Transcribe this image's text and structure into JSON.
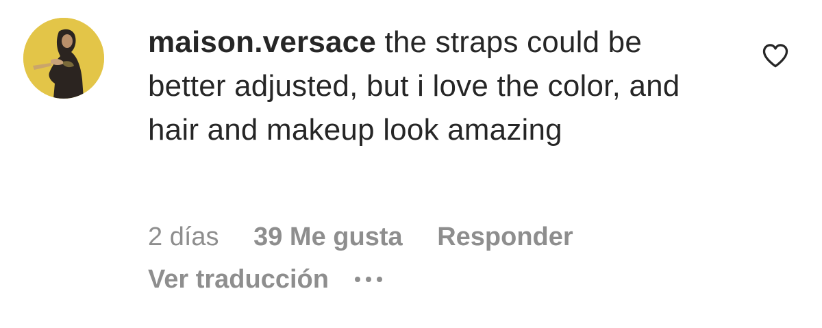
{
  "comment": {
    "username": "maison.versace",
    "text": " the straps could be better adjusted, but i love the color, and hair and makeup look amazing",
    "time": "2 días",
    "likes": "39 Me gusta",
    "reply_label": "Responder",
    "translate_label": "Ver traducción"
  },
  "icons": {
    "like": "heart-outline-icon",
    "more": "more-options-icon"
  },
  "colors": {
    "text": "#262626",
    "secondary": "#8e8e8e",
    "avatar_bg": "#e6c84a"
  }
}
